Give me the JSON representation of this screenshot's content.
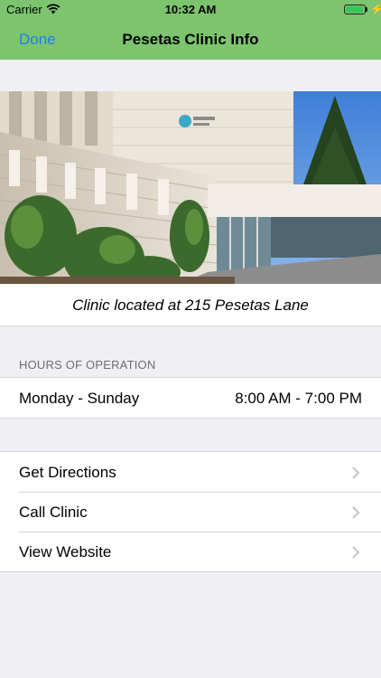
{
  "status_bar": {
    "carrier": "Carrier",
    "time": "10:32 AM",
    "battery_level": 0.9
  },
  "nav": {
    "done_label": "Done",
    "title": "Pesetas Clinic Info"
  },
  "photo": {
    "caption": "Clinic located at 215 Pesetas Lane"
  },
  "hours": {
    "header": "HOURS OF OPERATION",
    "days": "Monday - Sunday",
    "times": "8:00 AM - 7:00 PM"
  },
  "actions": [
    {
      "label": "Get Directions"
    },
    {
      "label": "Call Clinic"
    },
    {
      "label": "View Website"
    }
  ],
  "colors": {
    "nav_bar": "#7dc46e",
    "tint": "#1d7dfa",
    "background": "#efeff4"
  }
}
